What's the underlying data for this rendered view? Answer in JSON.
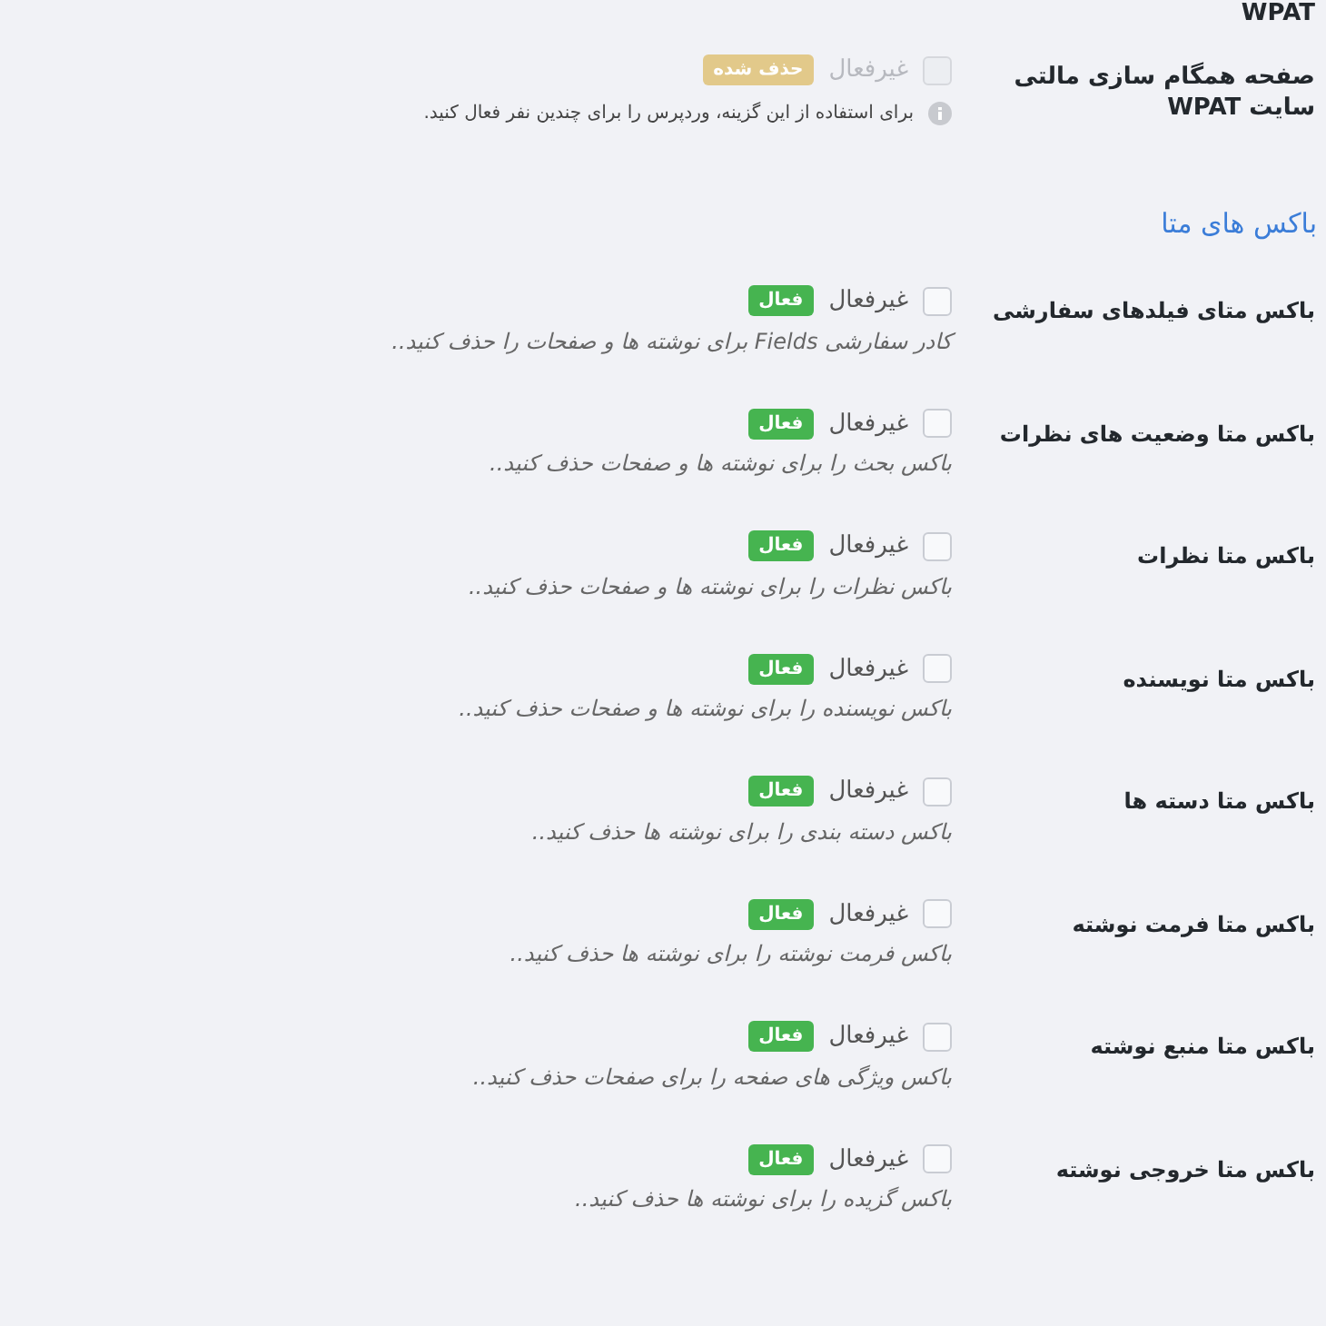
{
  "top_fragment": "WPAT",
  "sync_row": {
    "label": "صفحه همگام سازی مالتی سایت WPAT",
    "checked": false,
    "disabled": true,
    "toggle_label": "غیرفعال",
    "badge": {
      "text": "حذف شده",
      "kind": "removed"
    },
    "note": "برای استفاده از این گزینه، وردپرس را برای چندین نفر فعال کنید."
  },
  "section_title": "باکس های متا",
  "rows": [
    {
      "label": "باکس متای فیلدهای سفارشی",
      "checked": false,
      "disabled": false,
      "toggle_label": "غیرفعال",
      "badge": {
        "text": "فعال",
        "kind": "active"
      },
      "description": "کادر سفارشی Fields برای نوشته ها و صفحات را حذف کنید.."
    },
    {
      "label": "باکس متا وضعیت های نظرات",
      "checked": false,
      "disabled": false,
      "toggle_label": "غیرفعال",
      "badge": {
        "text": "فعال",
        "kind": "active"
      },
      "description": "باکس بحث را برای نوشته ها و صفحات حذف کنید.."
    },
    {
      "label": "باکس متا نظرات",
      "checked": false,
      "disabled": false,
      "toggle_label": "غیرفعال",
      "badge": {
        "text": "فعال",
        "kind": "active"
      },
      "description": "باکس نظرات را برای نوشته ها و صفحات حذف کنید.."
    },
    {
      "label": "باکس متا نویسنده",
      "checked": false,
      "disabled": false,
      "toggle_label": "غیرفعال",
      "badge": {
        "text": "فعال",
        "kind": "active"
      },
      "description": "باکس نویسنده را برای نوشته ها و صفحات حذف کنید.."
    },
    {
      "label": "باکس متا دسته ها",
      "checked": false,
      "disabled": false,
      "toggle_label": "غیرفعال",
      "badge": {
        "text": "فعال",
        "kind": "active"
      },
      "description": "باکس دسته بندی را برای نوشته ها حذف کنید.."
    },
    {
      "label": "باکس متا فرمت نوشته",
      "checked": false,
      "disabled": false,
      "toggle_label": "غیرفعال",
      "badge": {
        "text": "فعال",
        "kind": "active"
      },
      "description": "باکس فرمت نوشته را برای نوشته ها حذف کنید.."
    },
    {
      "label": "باکس متا منبع نوشته",
      "checked": false,
      "disabled": false,
      "toggle_label": "غیرفعال",
      "badge": {
        "text": "فعال",
        "kind": "active"
      },
      "description": "باکس ویژگی های صفحه را برای صفحات حذف کنید.."
    },
    {
      "label": "باکس متا خروجی نوشته",
      "checked": false,
      "disabled": false,
      "toggle_label": "غیرفعال",
      "badge": {
        "text": "فعال",
        "kind": "active"
      },
      "description": "باکس گزیده را برای نوشته ها حذف کنید.."
    }
  ]
}
